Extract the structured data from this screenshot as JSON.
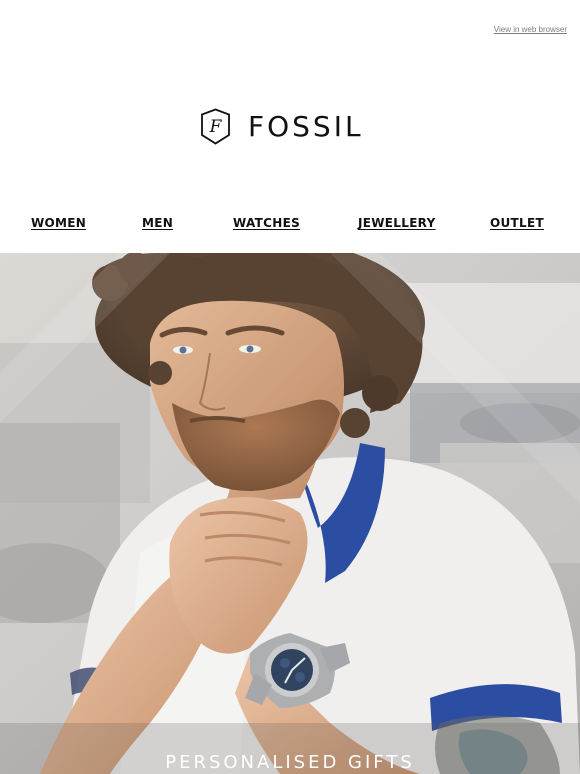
{
  "header": {
    "view_in_browser": "View in web browser"
  },
  "brand": {
    "name": "FOSSIL",
    "monogram": "F",
    "color": "#111111"
  },
  "nav": {
    "items": [
      {
        "label": "WOMEN"
      },
      {
        "label": "MEN"
      },
      {
        "label": "WATCHES"
      },
      {
        "label": "JEWELLERY"
      },
      {
        "label": "OUTLET"
      }
    ]
  },
  "hero": {
    "image": "man-with-watch-photo",
    "caption": "PERSONALISED GIFTS",
    "accent_color": "#1b3f9b"
  }
}
